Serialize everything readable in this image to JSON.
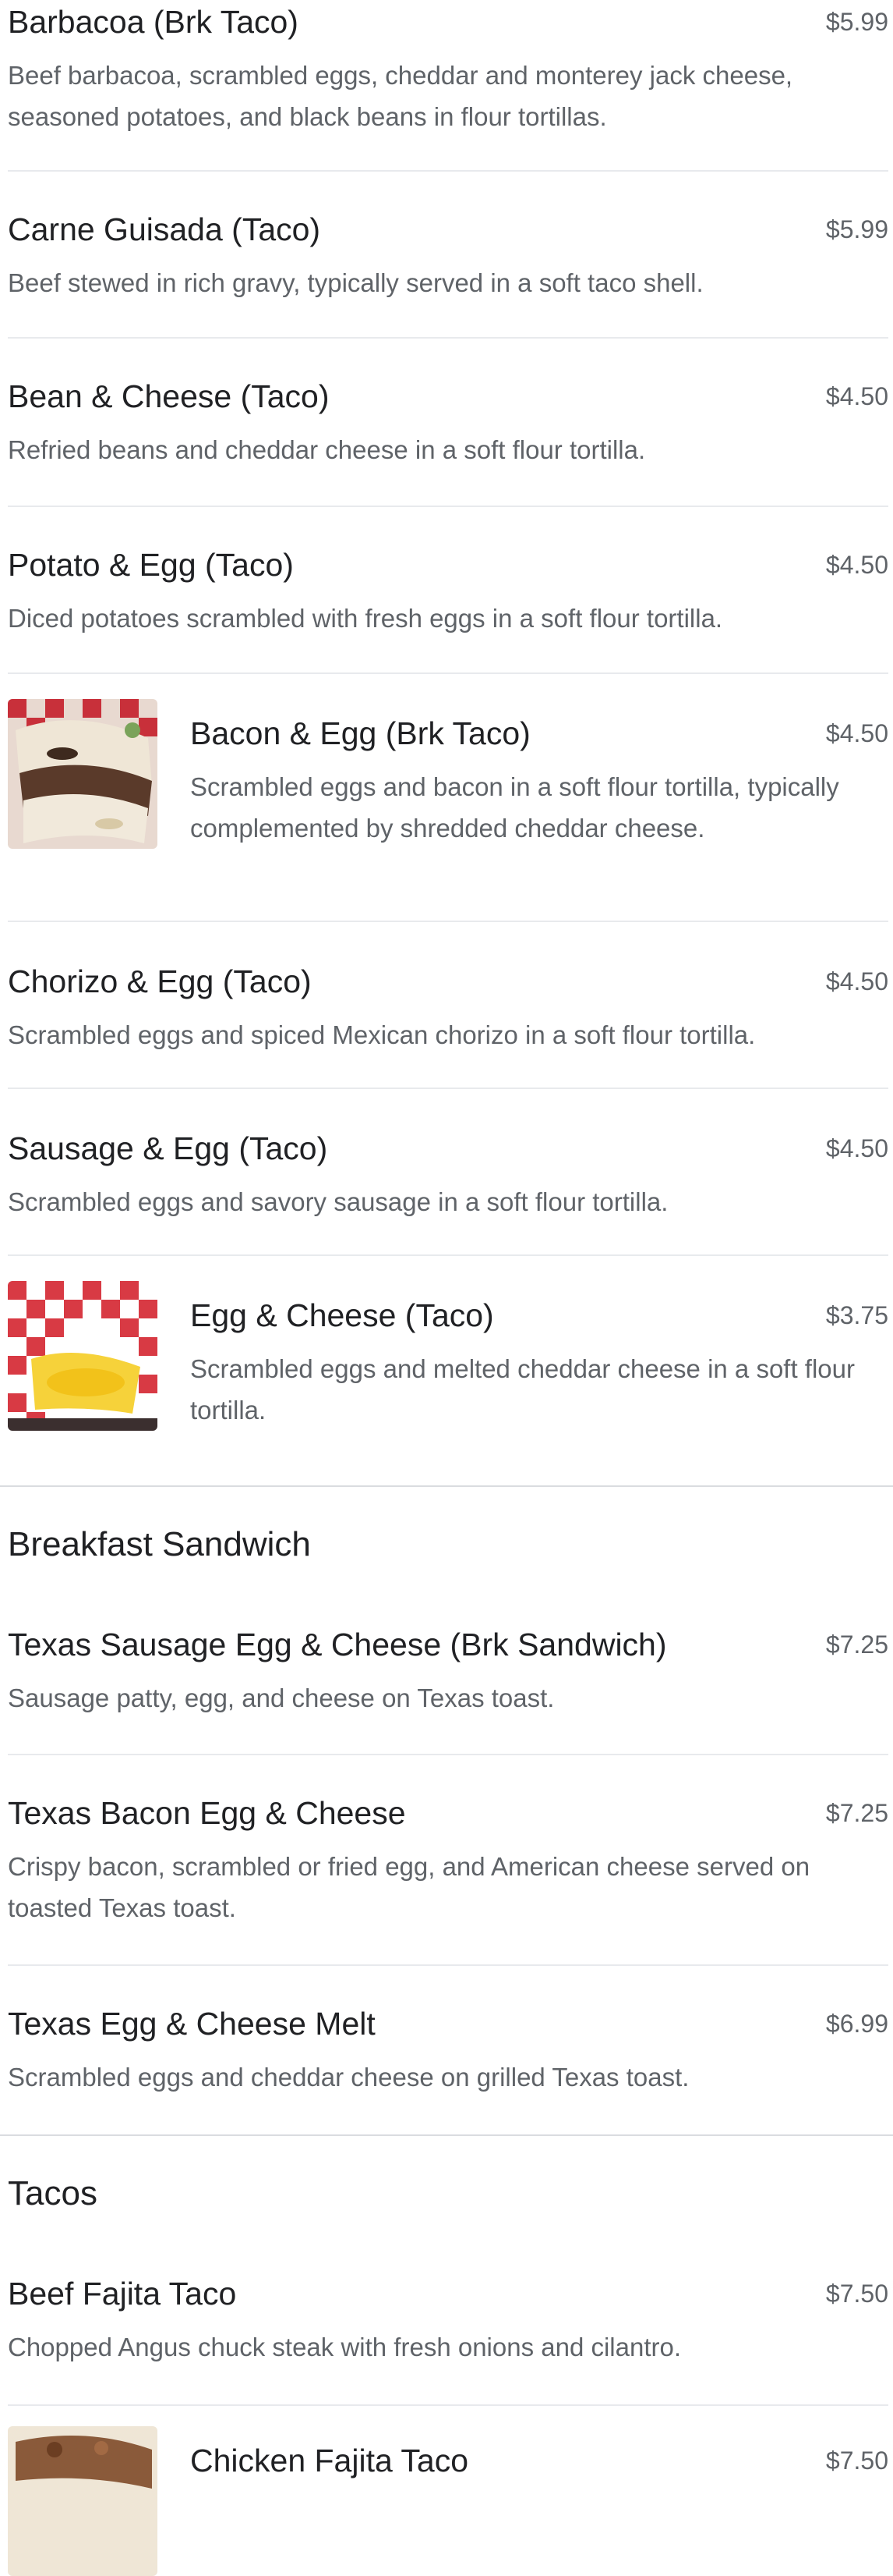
{
  "items": [
    {
      "title": "Barbacoa (Brk Taco)",
      "price": "$5.99",
      "desc": "Beef barbacoa, scrambled eggs, cheddar and monterey jack cheese, seasoned potatoes, and black beans in flour tortillas."
    },
    {
      "title": "Carne Guisada (Taco)",
      "price": "$5.99",
      "desc": "Beef stewed in rich gravy, typically served in a soft taco shell."
    },
    {
      "title": "Bean & Cheese (Taco)",
      "price": "$4.50",
      "desc": "Refried beans and cheddar cheese in a soft flour tortilla."
    },
    {
      "title": "Potato & Egg (Taco)",
      "price": "$4.50",
      "desc": "Diced potatoes scrambled with fresh eggs in a soft flour tortilla."
    },
    {
      "title": "Bacon & Egg (Brk Taco)",
      "price": "$4.50",
      "desc": "Scrambled eggs and bacon in a soft flour tortilla, typically complemented by shredded cheddar cheese."
    },
    {
      "title": "Chorizo & Egg (Taco)",
      "price": "$4.50",
      "desc": "Scrambled eggs and spiced Mexican chorizo in a soft flour tortilla."
    },
    {
      "title": "Sausage & Egg (Taco)",
      "price": "$4.50",
      "desc": "Scrambled eggs and savory sausage in a soft flour tortilla."
    },
    {
      "title": "Egg & Cheese (Taco)",
      "price": "$3.75",
      "desc": "Scrambled eggs and melted cheddar cheese in a soft flour tortilla."
    }
  ],
  "sections": [
    {
      "heading": "Breakfast Sandwich",
      "items": [
        {
          "title": "Texas Sausage Egg & Cheese (Brk Sandwich)",
          "price": "$7.25",
          "desc": "Sausage patty, egg, and cheese on Texas toast."
        },
        {
          "title": "Texas Bacon Egg & Cheese",
          "price": "$7.25",
          "desc": "Crispy bacon, scrambled or fried egg, and American cheese served on toasted Texas toast."
        },
        {
          "title": "Texas Egg & Cheese Melt",
          "price": "$6.99",
          "desc": "Scrambled eggs and cheddar cheese on grilled Texas toast."
        }
      ]
    },
    {
      "heading": "Tacos",
      "items": [
        {
          "title": "Beef Fajita Taco",
          "price": "$7.50",
          "desc": "Chopped Angus chuck steak with fresh onions and cilantro."
        },
        {
          "title": "Chicken Fajita Taco",
          "price": "$7.50",
          "desc": ""
        }
      ]
    }
  ]
}
